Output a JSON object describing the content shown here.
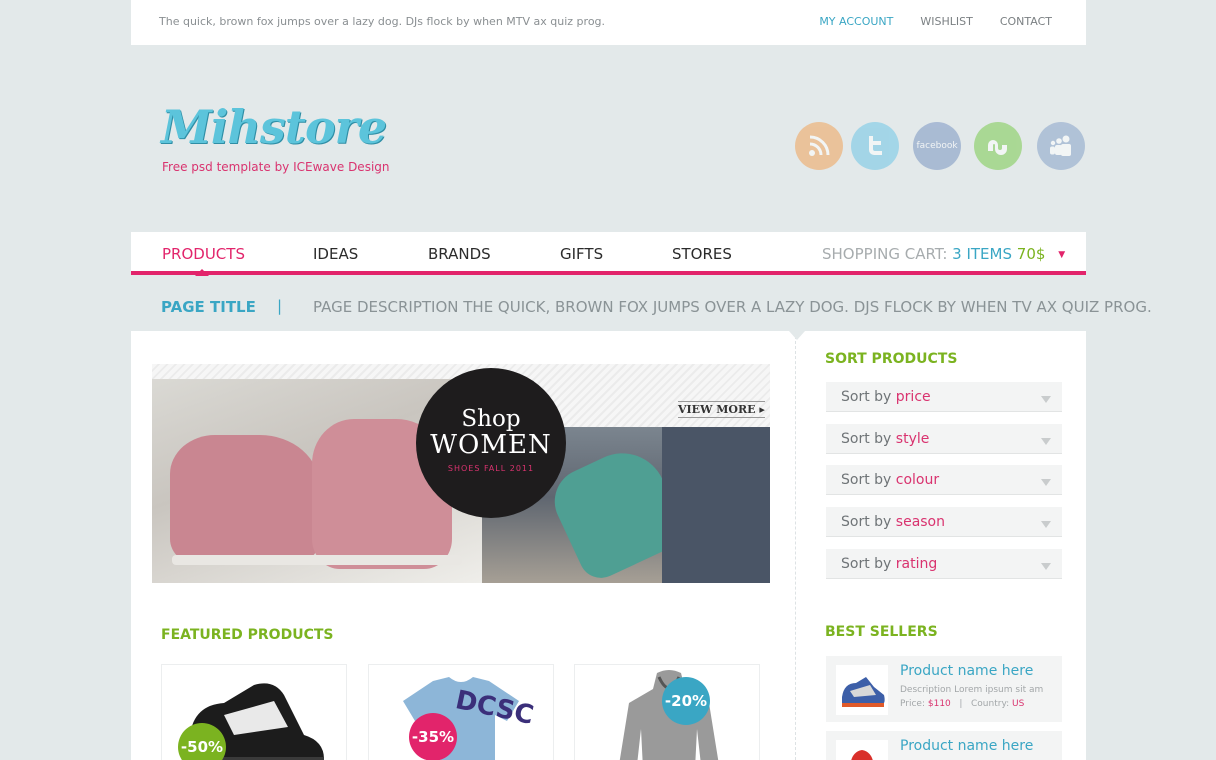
{
  "topbar": {
    "tagline": "The quick, brown fox jumps over a lazy dog. DJs flock by when MTV ax quiz prog.",
    "links": [
      "MY ACCOUNT",
      "WISHLIST",
      "CONTACT"
    ]
  },
  "logo": {
    "name": "Mihstore",
    "subtitle": "Free psd template by ICEwave Design"
  },
  "social": [
    "rss-icon",
    "twitter-icon",
    "facebook-icon",
    "stumbleupon-icon",
    "myspace-icon"
  ],
  "social_text": {
    "facebook": "facebook"
  },
  "nav": {
    "items": [
      "PRODUCTS",
      "IDEAS",
      "BRANDS",
      "GIFTS",
      "STORES"
    ],
    "active": "PRODUCTS",
    "cart_label": "SHOPPING CART:",
    "cart_items": "3 ITEMS",
    "cart_price": "70$",
    "cart_caret": "▼"
  },
  "page": {
    "title": "PAGE TITLE",
    "separator": "|",
    "description": "PAGE DESCRIPTION THE QUICK, BROWN FOX JUMPS OVER A LAZY DOG. DJS FLOCK BY WHEN TV AX QUIZ PROG."
  },
  "banner": {
    "line1": "Shop",
    "line2": "WOMEN",
    "line3": "SHOES FALL 2011",
    "view_more": "VIEW MORE ▸"
  },
  "featured": {
    "title": "FEATURED PRODUCTS",
    "badges": [
      "-50%",
      "-35%",
      "-20%"
    ],
    "badge_colors": [
      "#7bb320",
      "#e2246b",
      "#3aa6c4"
    ],
    "shirt_text": "DCSC"
  },
  "sort": {
    "title": "SORT PRODUCTS",
    "prefix": "Sort by",
    "options": [
      "price",
      "style",
      "colour",
      "season",
      "rating"
    ]
  },
  "best_sellers": {
    "title": "BEST SELLERS",
    "items": [
      {
        "name": "Product name here",
        "desc": "Description Lorem ipsum sit am",
        "price_label": "Price:",
        "price": "$110",
        "sep": "|",
        "country_label": "Country:",
        "country": "US"
      },
      {
        "name": "Product name here"
      }
    ]
  },
  "colors": {
    "accent_pink": "#e2246b",
    "accent_blue": "#3aa6c4",
    "accent_green": "#7bb320",
    "background": "#e3e9ea"
  }
}
